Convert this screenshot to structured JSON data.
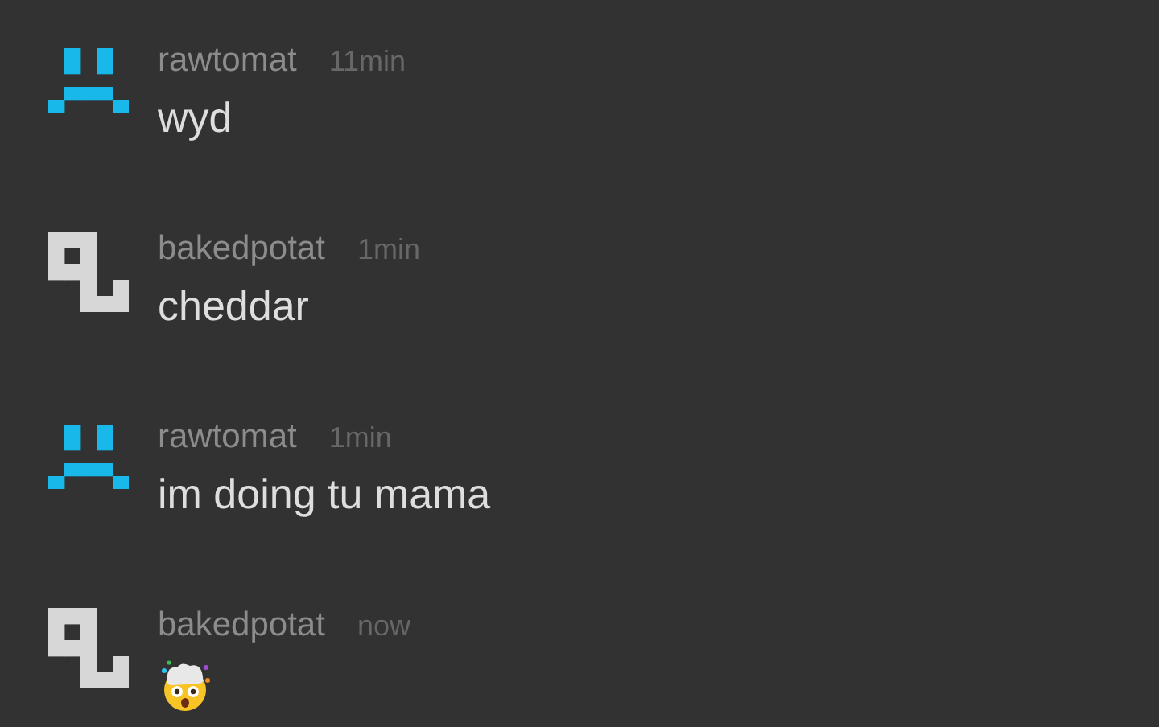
{
  "messages": [
    {
      "avatar": {
        "kind": "face"
      },
      "user": "rawtomat",
      "time": "11min",
      "kind": "text",
      "text": "wyd"
    },
    {
      "avatar": {
        "kind": "glyph"
      },
      "user": "bakedpotat",
      "time": "1min",
      "kind": "text",
      "text": "cheddar"
    },
    {
      "avatar": {
        "kind": "face"
      },
      "user": "rawtomat",
      "time": "1min",
      "kind": "text",
      "text": "im doing tu mama"
    },
    {
      "avatar": {
        "kind": "glyph"
      },
      "user": "bakedpotat",
      "time": "now",
      "kind": "emoji"
    }
  ]
}
